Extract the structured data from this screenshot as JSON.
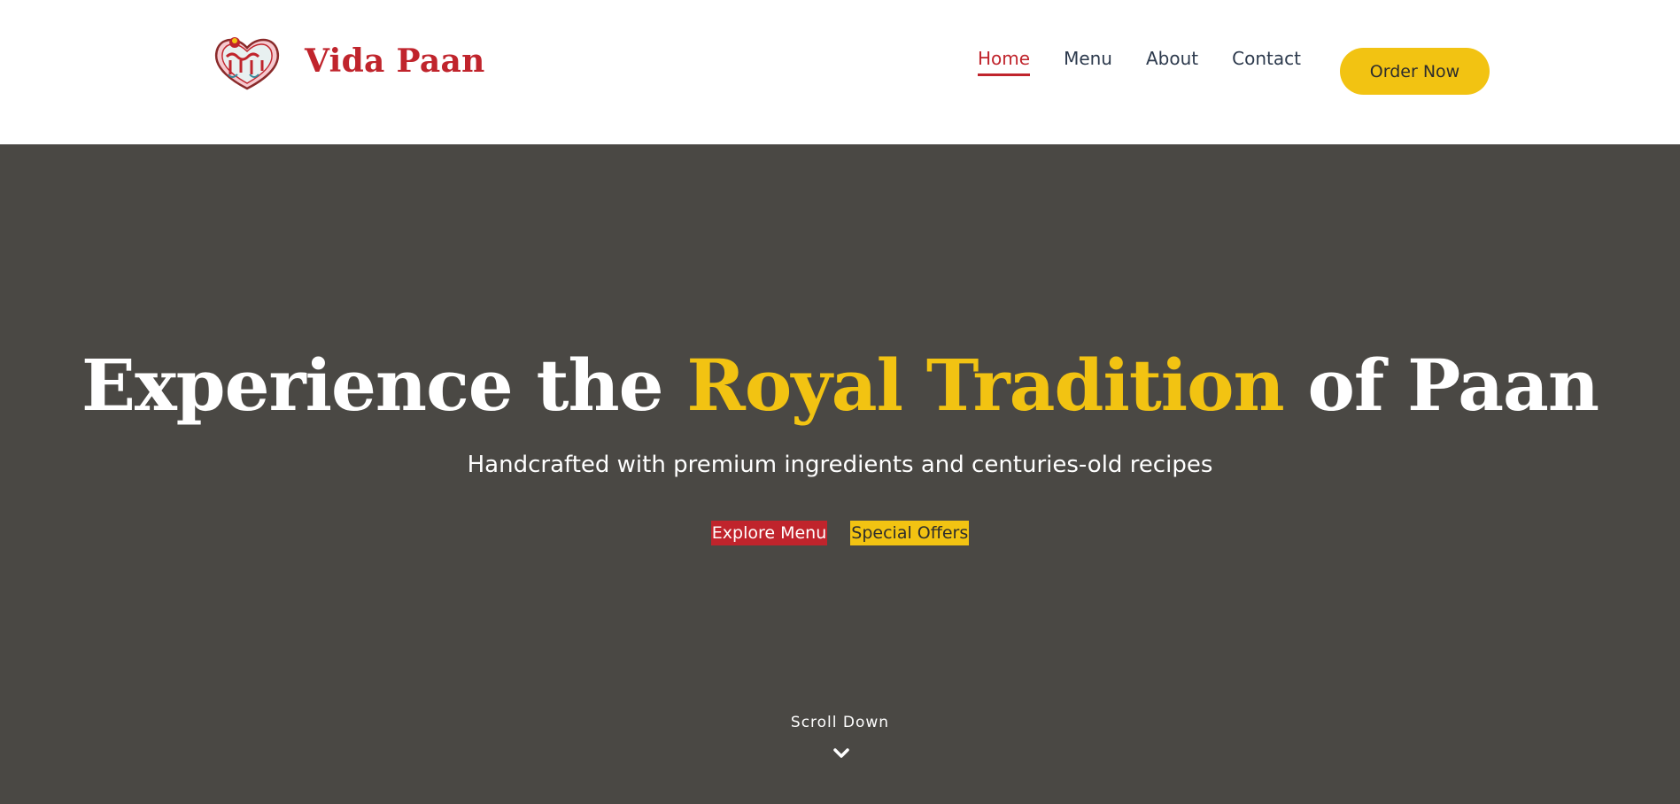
{
  "brand": {
    "name": "Vida Paan",
    "logo_icon": "paan-heart-logo-icon",
    "color": "#c0242c"
  },
  "nav": {
    "items": [
      {
        "label": "Home",
        "active": true
      },
      {
        "label": "Menu",
        "active": false
      },
      {
        "label": "About",
        "active": false
      },
      {
        "label": "Contact",
        "active": false
      }
    ],
    "cta_label": "Order Now"
  },
  "hero": {
    "title_part1": "Experience the ",
    "title_accent": "Royal Tradition",
    "title_part2": " of Paan",
    "subtitle": "Handcrafted with premium ingredients and centuries-old recipes",
    "primary_button": "Explore Menu",
    "secondary_button": "Special Offers",
    "scroll_label": "Scroll Down",
    "scroll_icon": "chevron-down-icon"
  },
  "colors": {
    "accent_red": "#c0242c",
    "accent_yellow": "#f2c312",
    "hero_bg": "#4a4844",
    "nav_text": "#2d3a4d"
  }
}
